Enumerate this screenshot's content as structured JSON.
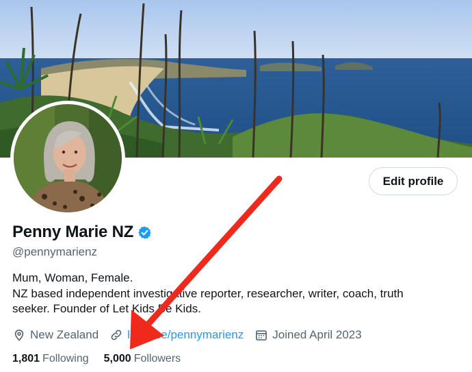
{
  "profile": {
    "display_name": "Penny Marie NZ",
    "handle": "@pennymarienz",
    "verified": true,
    "bio_line1": "Mum, Woman, Female.",
    "bio_line2": "NZ based independent investigative reporter, researcher, writer, coach, truth seeker. Founder of Let Kids Be Kids."
  },
  "actions": {
    "edit_profile_label": "Edit profile"
  },
  "meta": {
    "location": "New Zealand",
    "location_icon": "location-pin-icon",
    "website": "linktr.ee/pennymarienz",
    "website_icon": "link-icon",
    "joined": "Joined April 2023",
    "joined_icon": "calendar-icon"
  },
  "stats": {
    "following_count": "1,801",
    "following_label": "Following",
    "followers_count": "5,000",
    "followers_label": "Followers"
  },
  "colors": {
    "accent": "#1d9bf0",
    "text_primary": "#0f1419",
    "text_secondary": "#536471",
    "annotation_arrow": "#f0291d"
  }
}
